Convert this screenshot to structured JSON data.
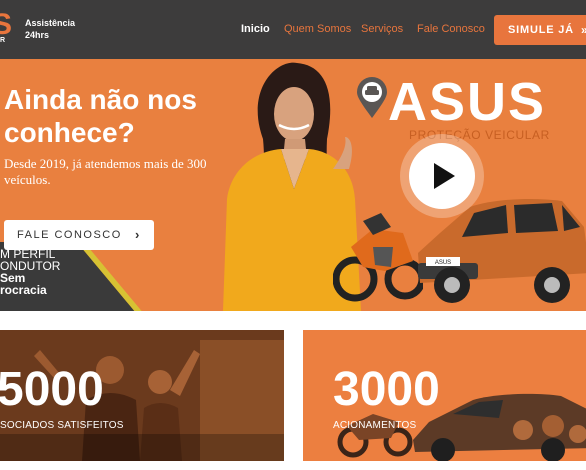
{
  "header": {
    "logo_letter": "S",
    "logo_rest": "R",
    "assist_line1": "Assistência",
    "assist_line2": "24hrs",
    "nav": [
      "Inicio",
      "Quem Somos",
      "Serviços",
      "Fale Conosco"
    ],
    "cta_label": "SIMULE JÁ",
    "cta_arrow": "»"
  },
  "hero": {
    "title": "Ainda não nos conhece?",
    "subtitle": "Desde 2019, já atendemos mais de 300 veículos.",
    "button_label": "FALE CONOSCO",
    "button_arrow": "›",
    "perfil_line1": "M PERFIL",
    "perfil_line2": "ONDUTOR",
    "perfil_line3": "Sem",
    "perfil_line4": "rocracia",
    "brand": "ASUS",
    "brand_tagline": "PROTEÇÃO VEICULAR",
    "plate_text": "ASUS"
  },
  "stats": [
    {
      "number": "5000",
      "label": "SOCIADOS SATISFEITOS"
    },
    {
      "number": "3000",
      "label": "ACIONAMENTOS"
    }
  ],
  "colors": {
    "accent": "#e8753d",
    "header_bg": "#3d3c3c",
    "hero_bg": "#e9803f"
  },
  "icons": {
    "pin": "car-pin-icon",
    "play": "play-icon",
    "arrow": "chevron-right-icon"
  }
}
